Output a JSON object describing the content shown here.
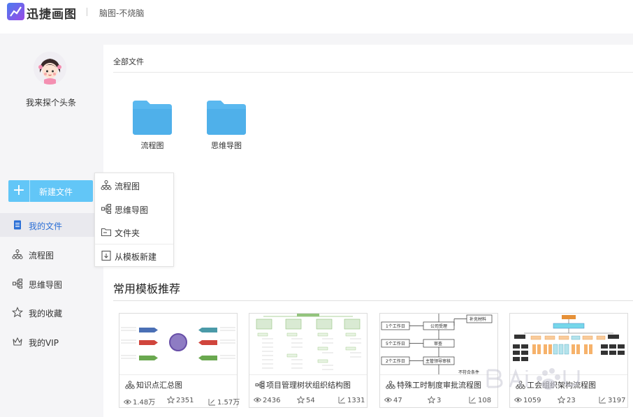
{
  "header": {
    "app_name": "迅捷画图",
    "subtitle": "脑图-不烧脑"
  },
  "sidebar": {
    "username": "我来探个头条",
    "new_button": "新建文件",
    "items": [
      {
        "label": "我的文件",
        "icon": "file-icon",
        "active": true
      },
      {
        "label": "流程图",
        "icon": "flowchart-icon"
      },
      {
        "label": "思维导图",
        "icon": "mindmap-icon"
      },
      {
        "label": "我的收藏",
        "icon": "star-icon"
      },
      {
        "label": "我的VIP",
        "icon": "crown-icon"
      }
    ]
  },
  "new_menu": {
    "items": [
      {
        "label": "流程图",
        "icon": "flowchart-icon"
      },
      {
        "label": "思维导图",
        "icon": "mindmap-icon"
      },
      {
        "label": "文件夹",
        "icon": "folder-outline-icon"
      },
      {
        "label": "从模板新建",
        "icon": "template-icon"
      }
    ]
  },
  "main": {
    "section_title": "全部文件",
    "folders": [
      {
        "name": "流程图"
      },
      {
        "name": "思维导图"
      }
    ],
    "recommend_title": "常用模板推荐",
    "templates": [
      {
        "title": "知识点汇总图",
        "views": "1.48万",
        "stars": "2351",
        "edits": "1.57万"
      },
      {
        "title": "项目管理树状组织结构图",
        "views": "2436",
        "stars": "54",
        "edits": "1331"
      },
      {
        "title": "特殊工时制度审批流程图",
        "views": "47",
        "stars": "3",
        "edits": "108"
      },
      {
        "title": "工会组织架构流程图",
        "views": "1059",
        "stars": "23",
        "edits": "3197"
      }
    ],
    "thumb3": {
      "left_labels": [
        "1个工作日",
        "5个工作日",
        "2个工作日"
      ],
      "boxes": [
        "公司受理",
        "审查",
        "主管领导审核"
      ],
      "side_labels": [
        "补充材料",
        "不符合条件"
      ]
    }
  },
  "colors": {
    "accent": "#62c6f7",
    "active_text": "#2b6fd6",
    "folder": "#5ab8ef"
  }
}
